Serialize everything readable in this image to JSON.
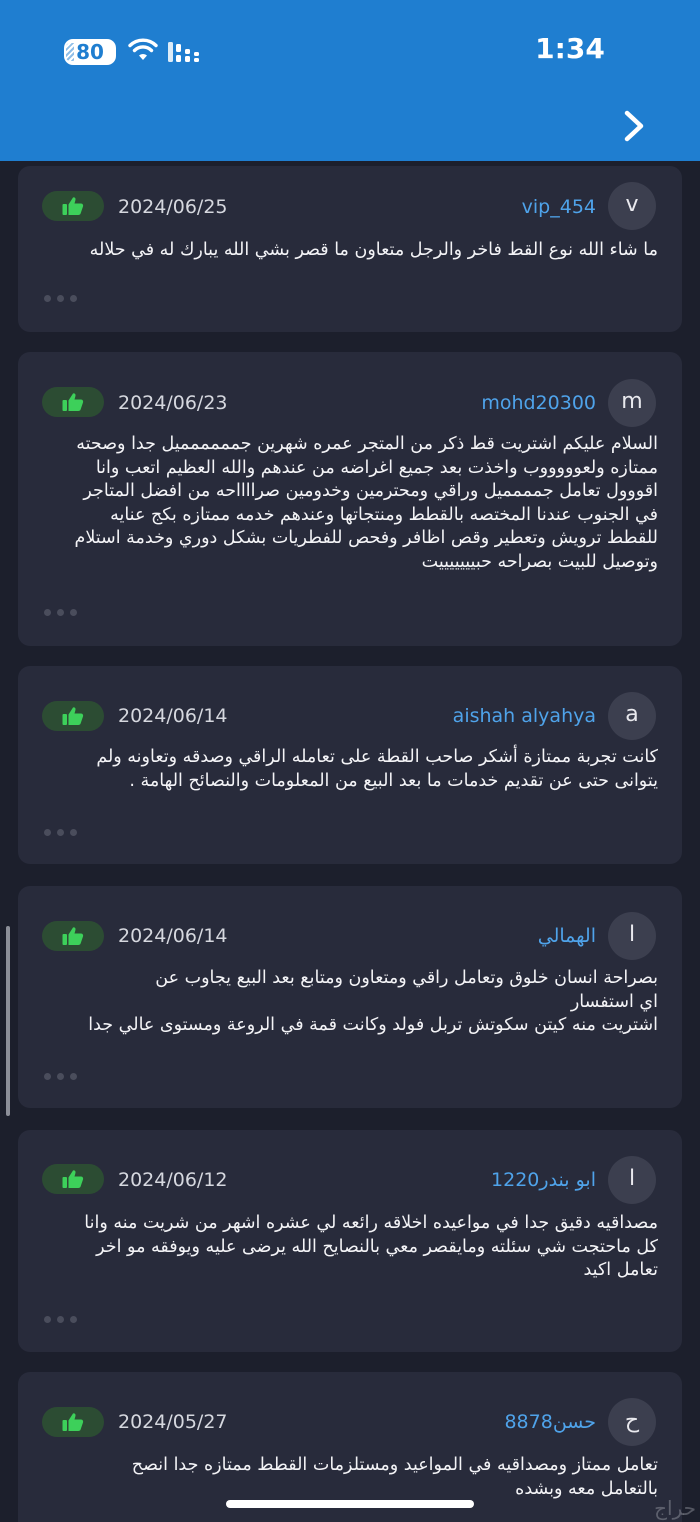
{
  "status_bar": {
    "battery": "80",
    "time": "1:34"
  },
  "header": {
    "nav_icon": "chevron-right-icon"
  },
  "reviews": [
    {
      "avatar_letter": "v",
      "username": "vip_454",
      "date": "2024/06/25",
      "like_icon": "thumbs-up-icon",
      "text": "ما شاء الله نوع القط فاخر والرجل متعاون ما قصر بشي الله يبارك له في حلاله"
    },
    {
      "avatar_letter": "m",
      "username": "mohd20300",
      "date": "2024/06/23",
      "like_icon": "thumbs-up-icon",
      "text": "السلام عليكم  اشتريت قط ذكر من المتجر عمره شهرين جمممممميل جدا وصحته\nممتازه ولعوووووب واخذت بعد جميع اغراضه من عندهم والله العظيم  اتعب وانا\nاقووول تعامل جمممميل وراقي ومحترمين وخدومين صرااااحه من افضل المتاجر\nفي الجنوب عندنا المختصه بالقطط ومنتجاتها وعندهم خدمه ممتازه بكج عنايه\nللقطط ترويش  وتعطير وقص اظافر وفحص للفطريات بشكل دوري وخدمة استلام\nوتوصيل للبيت بصراحه حبيييييييت"
    },
    {
      "avatar_letter": "a",
      "username": "aishah alyahya",
      "date": "2024/06/14",
      "like_icon": "thumbs-up-icon",
      "text": "كانت تجربة ممتازة أشكر صاحب القطة على تعامله الراقي وصدقه وتعاونه ولم\nيتوانى حتى عن تقديم خدمات ما بعد البيع من المعلومات والنصائح الهامة ."
    },
    {
      "avatar_letter": "ا",
      "username": "الهمالي",
      "date": "2024/06/14",
      "like_icon": "thumbs-up-icon",
      "text": "بصراحة انسان خلوق وتعامل راقي ومتعاون ومتابع بعد البيع يجاوب عن\nاي استفسار\nاشتريت منه كيتن سكوتش تربل فولد وكانت قمة في الروعة ومستوى عالي جدا"
    },
    {
      "avatar_letter": "ا",
      "username": "ابو بندر1220",
      "date": "2024/06/12",
      "like_icon": "thumbs-up-icon",
      "text": "مصداقيه دقيق جدا في مواعيده اخلاقه رائعه لي عشره  اشهر من شريت منه وانا\nكل ماحتجت شي سئلته ومايقصر معي بالنصايح الله يرضى عليه ويوفقه مو اخر\nتعامل اكيد"
    },
    {
      "avatar_letter": "ح",
      "username": "حسن8878",
      "date": "2024/05/27",
      "like_icon": "thumbs-up-icon",
      "text": "تعامل ممتاز ومصداقيه في المواعيد ومستلزمات القطط ممتازه جدا  انصح\nبالتعامل معه وبشده"
    }
  ],
  "more_icon": "more-dots-icon",
  "watermark": "حراج"
}
